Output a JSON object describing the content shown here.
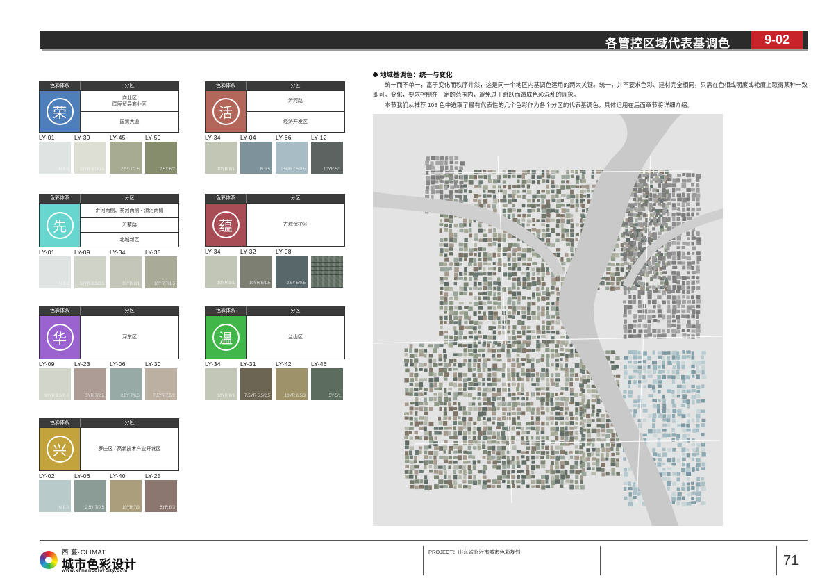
{
  "header": {
    "title": "各管控区域代表基调色",
    "number": "9-02"
  },
  "table_labels": {
    "system": "色彩体系",
    "zone": "分区"
  },
  "zones": [
    {
      "char": "荣",
      "color": "#4f7fba",
      "areas": [
        "商业区\n国际贸易商业区",
        "国贸大道"
      ],
      "swatches": [
        {
          "code": "LY-01",
          "notation": "N 9.0",
          "hex": "#dfe3e1"
        },
        {
          "code": "LY-39",
          "notation": "10YR 9.0/0.5",
          "hex": "#dddfd4"
        },
        {
          "code": "LY-45",
          "notation": "2.5Y 7/1.5",
          "hex": "#a6ab92"
        },
        {
          "code": "LY-50",
          "notation": "2.5Y 6/2",
          "hex": "#858d6c"
        }
      ]
    },
    {
      "char": "活",
      "color": "#b3675a",
      "areas": [
        "沂河路",
        "经济开发区"
      ],
      "swatches": [
        {
          "code": "LY-34",
          "notation": "10YR 8/1",
          "hex": "#c2c7b5"
        },
        {
          "code": "LY-04",
          "notation": "N 6.5",
          "hex": "#7d929a"
        },
        {
          "code": "LY-66",
          "notation": "7.5PB 7.5/0.5",
          "hex": "#a7bcc4"
        },
        {
          "code": "LY-12",
          "notation": "10YR 5/1",
          "hex": "#5c6360"
        }
      ]
    },
    {
      "char": "先",
      "color": "#67d6cf",
      "areas": [
        "沂河两侧、祊河两侧・涑河两侧",
        "沂蒙路",
        "北城新区"
      ],
      "swatches": [
        {
          "code": "LY-01",
          "notation": "N 9.0",
          "hex": "#dfe3e1"
        },
        {
          "code": "LY-09",
          "notation": "10YR 8.5/0.5",
          "hex": "#cfd3c8"
        },
        {
          "code": "LY-34",
          "notation": "10YR 8/1",
          "hex": "#c3c6b9"
        },
        {
          "code": "LY-35",
          "notation": "10YR 7/1.5",
          "hex": "#a9aa98"
        }
      ]
    },
    {
      "char": "蕴",
      "color": "#a84c55",
      "areas": [
        "古城保护区"
      ],
      "swatches": [
        {
          "code": "LY-34",
          "notation": "10YR 8/1",
          "hex": "#c2c6b6"
        },
        {
          "code": "LY-32",
          "notation": "10YR 6/1.5",
          "hex": "#7e7f73"
        },
        {
          "code": "LY-08",
          "notation": "2.5Y 5/0.5",
          "hex": "#58676a"
        },
        {
          "code": "",
          "notation": "",
          "hex": "#5d6a60",
          "texture": true
        }
      ]
    },
    {
      "char": "华",
      "color": "#9a63cf",
      "areas": [
        "河东区"
      ],
      "swatches": [
        {
          "code": "LY-09",
          "notation": "10YR 8.5/0.5",
          "hex": "#d2d5c9"
        },
        {
          "code": "LY-23",
          "notation": "5YR 7/2.5",
          "hex": "#ad9c96"
        },
        {
          "code": "LY-06",
          "notation": "2.5Y 7/0.5",
          "hex": "#97aaa6"
        },
        {
          "code": "LY-30",
          "notation": "7.5YR 7.5/2",
          "hex": "#bcb0a3"
        }
      ]
    },
    {
      "char": "温",
      "color": "#41b649",
      "areas": [
        "兰山区"
      ],
      "swatches": [
        {
          "code": "LY-34",
          "notation": "10YR 8/1",
          "hex": "#c2c7b7"
        },
        {
          "code": "LY-31",
          "notation": "7.5YR 5.5/2.5",
          "hex": "#6d6553"
        },
        {
          "code": "LY-42",
          "notation": "10YR 6.5/3",
          "hex": "#9d926a"
        },
        {
          "code": "LY-46",
          "notation": "5Y 5/1",
          "hex": "#5c6c5e"
        }
      ]
    },
    {
      "char": "兴",
      "color": "#c3a43c",
      "areas": [
        "罗庄区 / 高新技术产业开发区"
      ],
      "swatches": [
        {
          "code": "LY-02",
          "notation": "N 8.0",
          "hex": "#b9cacb"
        },
        {
          "code": "LY-06",
          "notation": "2.5Y 7/0.5",
          "hex": "#8b9b95"
        },
        {
          "code": "LY-40",
          "notation": "10YR 7/3",
          "hex": "#ab9e7c"
        },
        {
          "code": "LY-25",
          "notation": "5YR 6/3",
          "hex": "#8c7770"
        }
      ]
    }
  ],
  "intro": {
    "heading": "地域基调色：统一与变化",
    "paragraph1": "统一而不单一，富于变化而秩序井然，这是同一个地区内基调色运用的两大关键。统一，并不要求色彩、建材完全相同，只需在色相或明度或艳度上取得某种一致即可。变化，要求控制在一定的范围内，避免过于跳跃而造成色彩混乱的现象。",
    "paragraph2": "本节我们从推荐 108 色中选取了最有代表性的几个色彩作为各个分区的代表基调色，具体运用在后面章节将详细介绍。"
  },
  "footer": {
    "brand": "西 蔓·CLIMAT",
    "name": "城市色彩设计",
    "url": "www.ximancolorcity.com",
    "project": "PROJECT：山东省临沂市城市色彩规划",
    "page": "71"
  }
}
